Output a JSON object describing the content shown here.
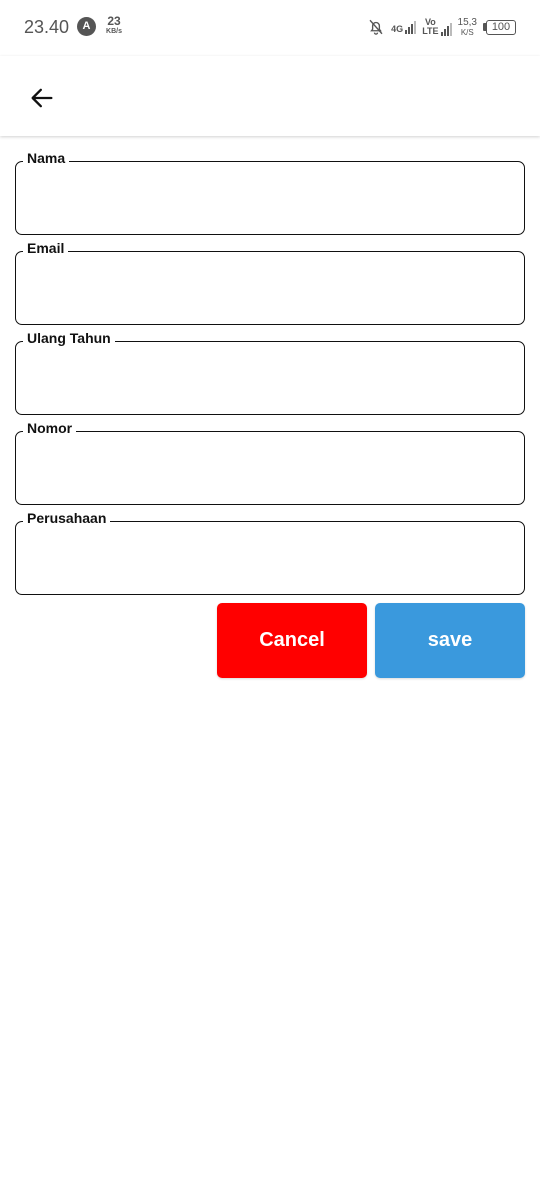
{
  "status_bar": {
    "time": "23.40",
    "app_icon": "A",
    "speed_value": "23",
    "speed_unit": "KB/s",
    "net1_label": "4G",
    "net2_label_top": "Vo",
    "net2_label_bottom": "LTE",
    "speed2_value": "15,3",
    "speed2_unit": "K/S",
    "battery": "100"
  },
  "app_bar": {
    "back_icon": "arrow-left-icon"
  },
  "form": {
    "fields": [
      {
        "label": "Nama",
        "value": ""
      },
      {
        "label": "Email",
        "value": ""
      },
      {
        "label": "Ulang Tahun",
        "value": ""
      },
      {
        "label": "Nomor",
        "value": ""
      },
      {
        "label": "Perusahaan",
        "value": ""
      }
    ]
  },
  "actions": {
    "cancel_label": "Cancel",
    "save_label": "save",
    "cancel_color": "#ff0000",
    "save_color": "#3a99dd"
  }
}
